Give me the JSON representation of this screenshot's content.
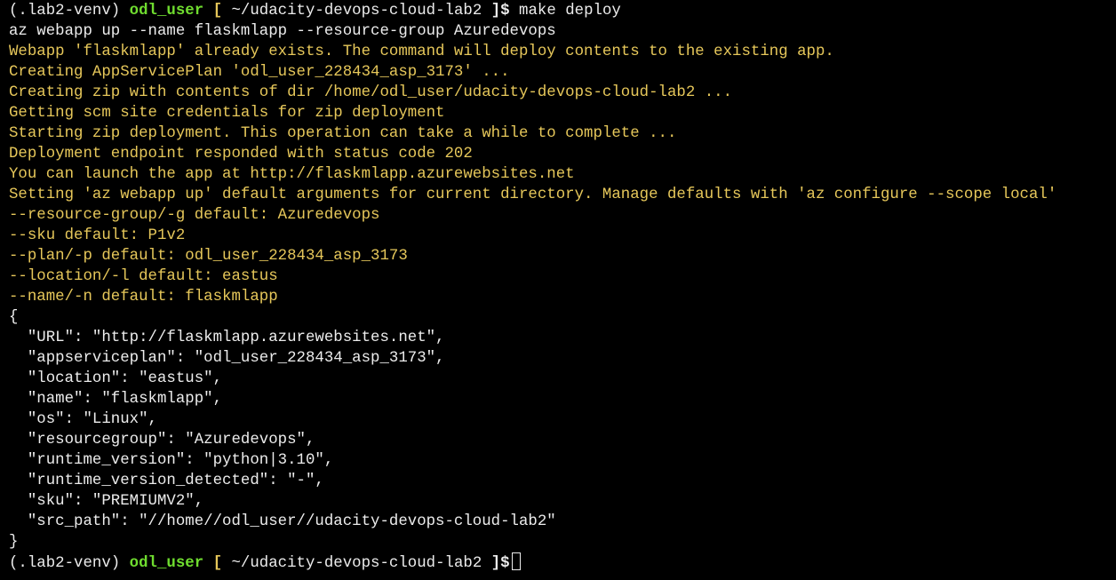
{
  "prompt": {
    "venv": "(.lab2-venv)",
    "user": "odl_user",
    "open_bracket": "[",
    "path": "~/udacity-devops-cloud-lab2",
    "close": "]$"
  },
  "first_command": "make deploy",
  "output_lines": [
    {
      "text": "az webapp up --name flaskmlapp --resource-group Azuredevops",
      "color": "white"
    },
    {
      "text": "Webapp 'flaskmlapp' already exists. The command will deploy contents to the existing app.",
      "color": "yellow"
    },
    {
      "text": "Creating AppServicePlan 'odl_user_228434_asp_3173' ...",
      "color": "yellow"
    },
    {
      "text": "Creating zip with contents of dir /home/odl_user/udacity-devops-cloud-lab2 ...",
      "color": "yellow"
    },
    {
      "text": "Getting scm site credentials for zip deployment",
      "color": "yellow"
    },
    {
      "text": "Starting zip deployment. This operation can take a while to complete ...",
      "color": "yellow"
    },
    {
      "text": "Deployment endpoint responded with status code 202",
      "color": "yellow"
    },
    {
      "text": "You can launch the app at http://flaskmlapp.azurewebsites.net",
      "color": "yellow"
    },
    {
      "text": "Setting 'az webapp up' default arguments for current directory. Manage defaults with 'az configure --scope local'",
      "color": "yellow"
    },
    {
      "text": "--resource-group/-g default: Azuredevops",
      "color": "yellow"
    },
    {
      "text": "--sku default: P1v2",
      "color": "yellow"
    },
    {
      "text": "--plan/-p default: odl_user_228434_asp_3173",
      "color": "yellow"
    },
    {
      "text": "--location/-l default: eastus",
      "color": "yellow"
    },
    {
      "text": "--name/-n default: flaskmlapp",
      "color": "yellow"
    },
    {
      "text": "{",
      "color": "white"
    },
    {
      "text": "  \"URL\": \"http://flaskmlapp.azurewebsites.net\",",
      "color": "white"
    },
    {
      "text": "  \"appserviceplan\": \"odl_user_228434_asp_3173\",",
      "color": "white"
    },
    {
      "text": "  \"location\": \"eastus\",",
      "color": "white"
    },
    {
      "text": "  \"name\": \"flaskmlapp\",",
      "color": "white"
    },
    {
      "text": "  \"os\": \"Linux\",",
      "color": "white"
    },
    {
      "text": "  \"resourcegroup\": \"Azuredevops\",",
      "color": "white"
    },
    {
      "text": "  \"runtime_version\": \"python|3.10\",",
      "color": "white"
    },
    {
      "text": "  \"runtime_version_detected\": \"-\",",
      "color": "white"
    },
    {
      "text": "  \"sku\": \"PREMIUMV2\",",
      "color": "white"
    },
    {
      "text": "  \"src_path\": \"//home//odl_user//udacity-devops-cloud-lab2\"",
      "color": "white"
    },
    {
      "text": "}",
      "color": "white"
    }
  ],
  "colors": {
    "background": "#000000",
    "white": "#ececec",
    "yellow": "#e6c75a",
    "green": "#6fdc2f"
  }
}
